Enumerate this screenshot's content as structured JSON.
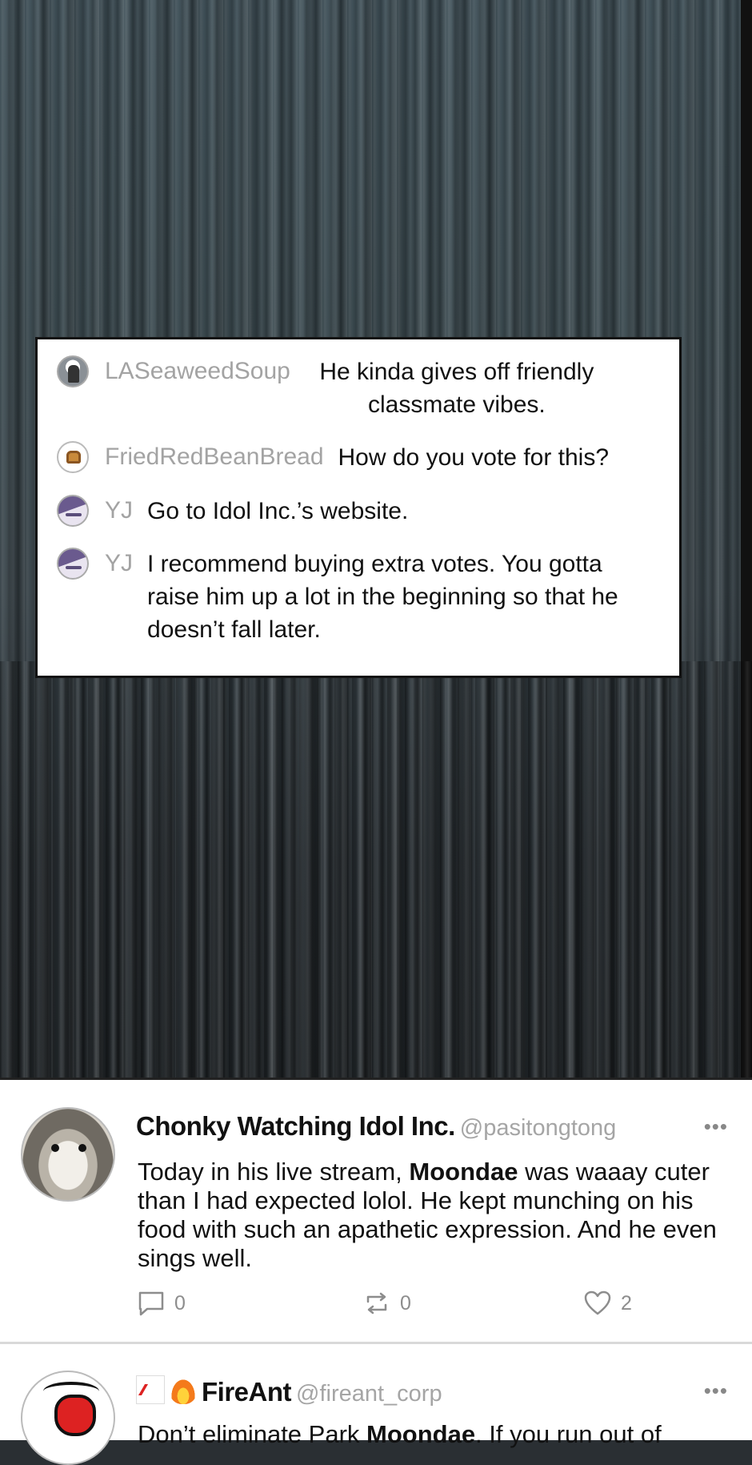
{
  "chat": {
    "messages": [
      {
        "user": "LASeaweedSoup",
        "avatar": "seaweed-soup-avatar",
        "text": "He kinda gives off friendly classmate vibes."
      },
      {
        "user": "FriedRedBeanBread",
        "avatar": "bread-avatar",
        "text": "How do you vote for this?"
      },
      {
        "user": "YJ",
        "avatar": "yj-avatar",
        "text": "Go to Idol Inc.’s website."
      },
      {
        "user": "YJ",
        "avatar": "yj-avatar",
        "text": "I recommend buying extra votes. You gotta raise him up a lot in the beginning so that he doesn’t fall later."
      }
    ]
  },
  "feed": {
    "posts": [
      {
        "name": "Chonky Watching Idol Inc.",
        "handle": "@pasitongtong",
        "text_parts": [
          "Today in his live stream, ",
          "Moondae",
          " was waaay cuter than I had expected lolol. He kept munching on his food with such an apathetic expression. And he even sings well."
        ],
        "reply_count": "0",
        "repost_count": "0",
        "like_count": "2",
        "more_label": "•••"
      },
      {
        "name": "FireAnt",
        "handle": "@fireant_corp",
        "emojis": [
          "chart-increasing-icon",
          "fire-icon"
        ],
        "text_parts": [
          "Don’t eliminate Park ",
          "Moondae",
          ". If you run out of"
        ],
        "more_label": "•••"
      }
    ]
  },
  "colors": {
    "username_gray": "#a3a3a3",
    "accent_text": "#111111",
    "icon_gray": "#8d8d8d"
  }
}
